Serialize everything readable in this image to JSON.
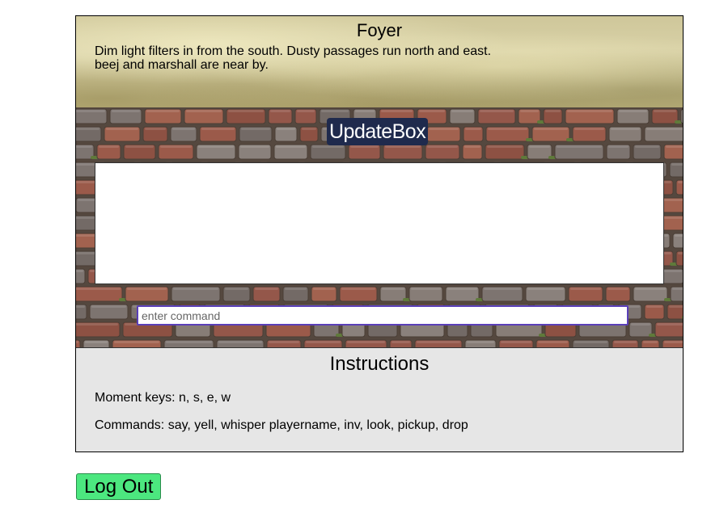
{
  "room": {
    "title": "Foyer",
    "description": "Dim light filters in from the south. Dusty passages run north and east.",
    "players": "beej and marshall are near by."
  },
  "update_box": {
    "title": "UpdateBox",
    "content": ""
  },
  "command": {
    "value": "",
    "placeholder": "enter command"
  },
  "instructions": {
    "title": "Instructions",
    "movement": "Moment keys: n, s, e, w",
    "commands": "Commands: say, yell, whisper playername, inv, look, pickup, drop"
  },
  "logout": {
    "label": "Log Out"
  },
  "colors": {
    "update_title_bg": "#1f2a4d",
    "logout_bg": "#4ce77f",
    "input_border": "#5a3fb8",
    "instructions_bg": "#e6e6e6",
    "brick_red": "#9b5a4a",
    "brick_grey": "#7d7470",
    "mortar": "#55483f"
  }
}
